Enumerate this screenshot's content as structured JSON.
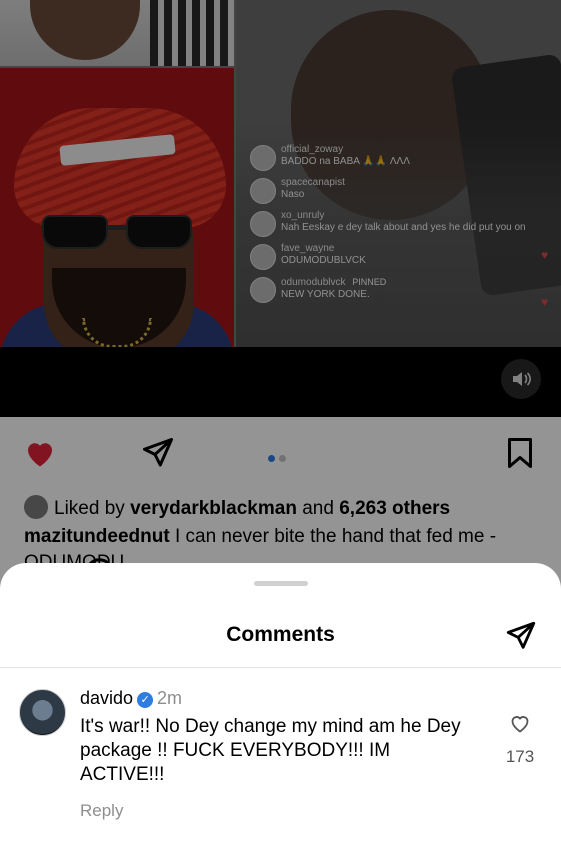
{
  "media": {
    "live_comments": [
      {
        "user": "official_zoway",
        "text": "BADDO na BABA 🙏🙏 ΛΛΛ"
      },
      {
        "user": "spacecanapist",
        "text": "Naso"
      },
      {
        "user": "xo_unruly",
        "text": "Nah Eeskay e dey talk about and yes he did put you on"
      },
      {
        "user": "fave_wayne",
        "text": "ODUMODUBLVCK"
      },
      {
        "user": "odumodublvck",
        "text": "NEW YORK DONE.",
        "badge": "PINNED"
      }
    ],
    "sound_icon": "speaker-icon"
  },
  "post": {
    "liked_by_prefix": "Liked by",
    "liked_by_user": "verydarkblackman",
    "liked_by_and": "and",
    "liked_by_others": "6,263 others",
    "caption_user": "mazitundeednut",
    "caption_text": "I can never bite the hand that fed me - ODUMODU",
    "carousel_pages": 2,
    "carousel_active": 1,
    "icons": [
      "heart-filled-icon",
      "comment-icon",
      "share-icon",
      "bookmark-icon"
    ],
    "like_color": "#e0243a"
  },
  "sheet": {
    "title": "Comments",
    "comments": [
      {
        "user": "davido",
        "verified": true,
        "time": "2m",
        "text": "It's war!! No Dey change my mind am he Dey package !! FUCK EVERYBODY!!! IM ACTIVE!!!",
        "reply_label": "Reply",
        "like_count": "173"
      }
    ]
  },
  "colors": {
    "verified_blue": "#2f7de1",
    "muted_text": "#8e8e8e"
  }
}
